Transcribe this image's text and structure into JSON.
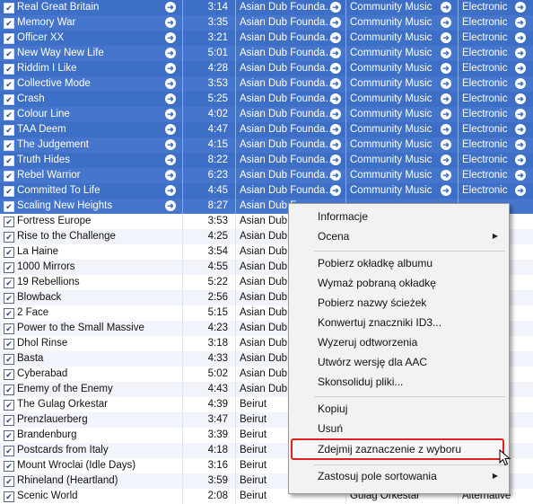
{
  "tracks": [
    {
      "name": "Real Great Britain",
      "time": "3:14",
      "artist": "Asian Dub Founda…",
      "album": "Community Music",
      "genre": "Electronic",
      "selected": true
    },
    {
      "name": "Memory War",
      "time": "3:35",
      "artist": "Asian Dub Founda…",
      "album": "Community Music",
      "genre": "Electronic",
      "selected": true
    },
    {
      "name": "Officer XX",
      "time": "3:21",
      "artist": "Asian Dub Founda…",
      "album": "Community Music",
      "genre": "Electronic",
      "selected": true
    },
    {
      "name": "New Way New Life",
      "time": "5:01",
      "artist": "Asian Dub Founda…",
      "album": "Community Music",
      "genre": "Electronic",
      "selected": true
    },
    {
      "name": "Riddim I Like",
      "time": "4:28",
      "artist": "Asian Dub Founda…",
      "album": "Community Music",
      "genre": "Electronic",
      "selected": true
    },
    {
      "name": "Collective Mode",
      "time": "3:53",
      "artist": "Asian Dub Founda…",
      "album": "Community Music",
      "genre": "Electronic",
      "selected": true
    },
    {
      "name": "Crash",
      "time": "5:25",
      "artist": "Asian Dub Founda…",
      "album": "Community Music",
      "genre": "Electronic",
      "selected": true
    },
    {
      "name": "Colour Line",
      "time": "4:02",
      "artist": "Asian Dub Founda…",
      "album": "Community Music",
      "genre": "Electronic",
      "selected": true
    },
    {
      "name": "TAA Deem",
      "time": "4:47",
      "artist": "Asian Dub Founda…",
      "album": "Community Music",
      "genre": "Electronic",
      "selected": true
    },
    {
      "name": "The Judgement",
      "time": "4:15",
      "artist": "Asian Dub Founda…",
      "album": "Community Music",
      "genre": "Electronic",
      "selected": true
    },
    {
      "name": "Truth Hides",
      "time": "8:22",
      "artist": "Asian Dub Founda…",
      "album": "Community Music",
      "genre": "Electronic",
      "selected": true
    },
    {
      "name": "Rebel Warrior",
      "time": "6:23",
      "artist": "Asian Dub Founda…",
      "album": "Community Music",
      "genre": "Electronic",
      "selected": true
    },
    {
      "name": "Committed To Life",
      "time": "4:45",
      "artist": "Asian Dub Founda…",
      "album": "Community Music",
      "genre": "Electronic",
      "selected": true
    },
    {
      "name": "Scaling New Heights",
      "time": "8:27",
      "artist": "Asian Dub F",
      "album": "",
      "genre": "",
      "selected": true
    },
    {
      "name": "Fortress Europe",
      "time": "3:53",
      "artist": "Asian Dub F",
      "album": "",
      "genre": "",
      "selected": false
    },
    {
      "name": "Rise to the Challenge",
      "time": "4:25",
      "artist": "Asian Dub F",
      "album": "",
      "genre": "",
      "selected": false
    },
    {
      "name": "La Haine",
      "time": "3:54",
      "artist": "Asian Dub F",
      "album": "",
      "genre": "",
      "selected": false
    },
    {
      "name": "1000 Mirrors",
      "time": "4:55",
      "artist": "Asian Dub F",
      "album": "",
      "genre": "",
      "selected": false
    },
    {
      "name": "19 Rebellions",
      "time": "5:22",
      "artist": "Asian Dub F",
      "album": "",
      "genre": "",
      "selected": false
    },
    {
      "name": "Blowback",
      "time": "2:56",
      "artist": "Asian Dub F",
      "album": "",
      "genre": "",
      "selected": false
    },
    {
      "name": "2 Face",
      "time": "5:15",
      "artist": "Asian Dub F",
      "album": "",
      "genre": "",
      "selected": false
    },
    {
      "name": "Power to the Small Massive",
      "time": "4:23",
      "artist": "Asian Dub F",
      "album": "",
      "genre": "",
      "selected": false
    },
    {
      "name": "Dhol Rinse",
      "time": "3:18",
      "artist": "Asian Dub F",
      "album": "",
      "genre": "",
      "selected": false
    },
    {
      "name": "Basta",
      "time": "4:33",
      "artist": "Asian Dub F",
      "album": "",
      "genre": "",
      "selected": false
    },
    {
      "name": "Cyberabad",
      "time": "5:02",
      "artist": "Asian Dub F",
      "album": "",
      "genre": "",
      "selected": false
    },
    {
      "name": "Enemy of the Enemy",
      "time": "4:43",
      "artist": "Asian Dub F",
      "album": "",
      "genre": "",
      "selected": false
    },
    {
      "name": "The Gulag Orkestar",
      "time": "4:39",
      "artist": "Beirut",
      "album": "",
      "genre": "",
      "selected": false
    },
    {
      "name": "Prenzlauerberg",
      "time": "3:47",
      "artist": "Beirut",
      "album": "",
      "genre": "",
      "selected": false
    },
    {
      "name": "Brandenburg",
      "time": "3:39",
      "artist": "Beirut",
      "album": "",
      "genre": "",
      "selected": false
    },
    {
      "name": "Postcards from Italy",
      "time": "4:18",
      "artist": "Beirut",
      "album": "",
      "genre": "",
      "selected": false
    },
    {
      "name": "Mount Wroclai (Idle Days)",
      "time": "3:16",
      "artist": "Beirut",
      "album": "",
      "genre": "",
      "selected": false
    },
    {
      "name": "Rhineland (Heartland)",
      "time": "3:59",
      "artist": "Beirut",
      "album": "",
      "genre": "",
      "selected": false
    },
    {
      "name": "Scenic World",
      "time": "2:08",
      "artist": "Beirut",
      "album": "Gulag Orkestar",
      "genre": "Alternative",
      "selected": false
    }
  ],
  "menu": {
    "info": "Informacje",
    "rating": "Ocena",
    "get_artwork": "Pobierz okładkę albumu",
    "clear_artwork": "Wymaż pobraną okładkę",
    "get_track_names": "Pobierz nazwy ścieżek",
    "convert_id3": "Konwertuj znaczniki ID3...",
    "reset_plays": "Wyzeruj odtworzenia",
    "create_aac": "Utwórz wersję dla AAC",
    "consolidate": "Skonsoliduj pliki...",
    "copy": "Kopiuj",
    "delete": "Usuń",
    "uncheck_selection": "Zdejmij zaznaczenie z wyboru",
    "apply_sort_field": "Zastosuj pole sortowania"
  },
  "colors": {
    "selection": "#3d6fc7",
    "highlight_border": "#e0221e"
  }
}
